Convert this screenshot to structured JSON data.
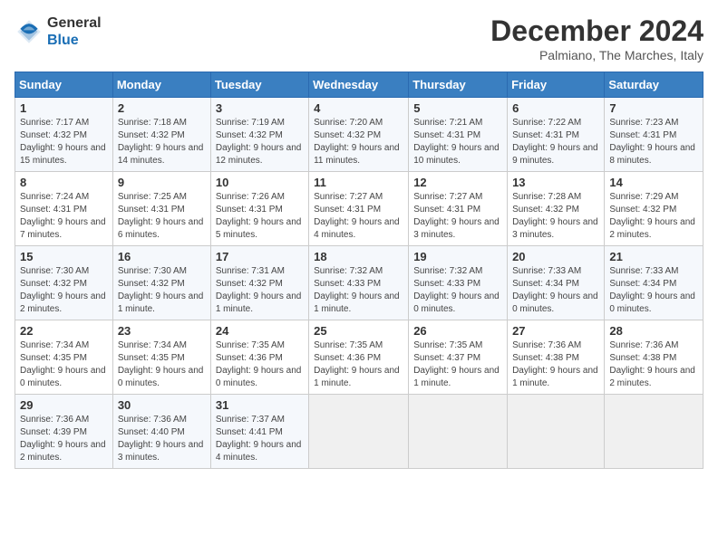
{
  "header": {
    "logo_line1": "General",
    "logo_line2": "Blue",
    "month": "December 2024",
    "location": "Palmiano, The Marches, Italy"
  },
  "weekdays": [
    "Sunday",
    "Monday",
    "Tuesday",
    "Wednesday",
    "Thursday",
    "Friday",
    "Saturday"
  ],
  "weeks": [
    [
      {
        "day": 1,
        "info": "Sunrise: 7:17 AM\nSunset: 4:32 PM\nDaylight: 9 hours and 15 minutes."
      },
      {
        "day": 2,
        "info": "Sunrise: 7:18 AM\nSunset: 4:32 PM\nDaylight: 9 hours and 14 minutes."
      },
      {
        "day": 3,
        "info": "Sunrise: 7:19 AM\nSunset: 4:32 PM\nDaylight: 9 hours and 12 minutes."
      },
      {
        "day": 4,
        "info": "Sunrise: 7:20 AM\nSunset: 4:32 PM\nDaylight: 9 hours and 11 minutes."
      },
      {
        "day": 5,
        "info": "Sunrise: 7:21 AM\nSunset: 4:31 PM\nDaylight: 9 hours and 10 minutes."
      },
      {
        "day": 6,
        "info": "Sunrise: 7:22 AM\nSunset: 4:31 PM\nDaylight: 9 hours and 9 minutes."
      },
      {
        "day": 7,
        "info": "Sunrise: 7:23 AM\nSunset: 4:31 PM\nDaylight: 9 hours and 8 minutes."
      }
    ],
    [
      {
        "day": 8,
        "info": "Sunrise: 7:24 AM\nSunset: 4:31 PM\nDaylight: 9 hours and 7 minutes."
      },
      {
        "day": 9,
        "info": "Sunrise: 7:25 AM\nSunset: 4:31 PM\nDaylight: 9 hours and 6 minutes."
      },
      {
        "day": 10,
        "info": "Sunrise: 7:26 AM\nSunset: 4:31 PM\nDaylight: 9 hours and 5 minutes."
      },
      {
        "day": 11,
        "info": "Sunrise: 7:27 AM\nSunset: 4:31 PM\nDaylight: 9 hours and 4 minutes."
      },
      {
        "day": 12,
        "info": "Sunrise: 7:27 AM\nSunset: 4:31 PM\nDaylight: 9 hours and 3 minutes."
      },
      {
        "day": 13,
        "info": "Sunrise: 7:28 AM\nSunset: 4:32 PM\nDaylight: 9 hours and 3 minutes."
      },
      {
        "day": 14,
        "info": "Sunrise: 7:29 AM\nSunset: 4:32 PM\nDaylight: 9 hours and 2 minutes."
      }
    ],
    [
      {
        "day": 15,
        "info": "Sunrise: 7:30 AM\nSunset: 4:32 PM\nDaylight: 9 hours and 2 minutes."
      },
      {
        "day": 16,
        "info": "Sunrise: 7:30 AM\nSunset: 4:32 PM\nDaylight: 9 hours and 1 minute."
      },
      {
        "day": 17,
        "info": "Sunrise: 7:31 AM\nSunset: 4:32 PM\nDaylight: 9 hours and 1 minute."
      },
      {
        "day": 18,
        "info": "Sunrise: 7:32 AM\nSunset: 4:33 PM\nDaylight: 9 hours and 1 minute."
      },
      {
        "day": 19,
        "info": "Sunrise: 7:32 AM\nSunset: 4:33 PM\nDaylight: 9 hours and 0 minutes."
      },
      {
        "day": 20,
        "info": "Sunrise: 7:33 AM\nSunset: 4:34 PM\nDaylight: 9 hours and 0 minutes."
      },
      {
        "day": 21,
        "info": "Sunrise: 7:33 AM\nSunset: 4:34 PM\nDaylight: 9 hours and 0 minutes."
      }
    ],
    [
      {
        "day": 22,
        "info": "Sunrise: 7:34 AM\nSunset: 4:35 PM\nDaylight: 9 hours and 0 minutes."
      },
      {
        "day": 23,
        "info": "Sunrise: 7:34 AM\nSunset: 4:35 PM\nDaylight: 9 hours and 0 minutes."
      },
      {
        "day": 24,
        "info": "Sunrise: 7:35 AM\nSunset: 4:36 PM\nDaylight: 9 hours and 0 minutes."
      },
      {
        "day": 25,
        "info": "Sunrise: 7:35 AM\nSunset: 4:36 PM\nDaylight: 9 hours and 1 minute."
      },
      {
        "day": 26,
        "info": "Sunrise: 7:35 AM\nSunset: 4:37 PM\nDaylight: 9 hours and 1 minute."
      },
      {
        "day": 27,
        "info": "Sunrise: 7:36 AM\nSunset: 4:38 PM\nDaylight: 9 hours and 1 minute."
      },
      {
        "day": 28,
        "info": "Sunrise: 7:36 AM\nSunset: 4:38 PM\nDaylight: 9 hours and 2 minutes."
      }
    ],
    [
      {
        "day": 29,
        "info": "Sunrise: 7:36 AM\nSunset: 4:39 PM\nDaylight: 9 hours and 2 minutes."
      },
      {
        "day": 30,
        "info": "Sunrise: 7:36 AM\nSunset: 4:40 PM\nDaylight: 9 hours and 3 minutes."
      },
      {
        "day": 31,
        "info": "Sunrise: 7:37 AM\nSunset: 4:41 PM\nDaylight: 9 hours and 4 minutes."
      },
      null,
      null,
      null,
      null
    ]
  ]
}
